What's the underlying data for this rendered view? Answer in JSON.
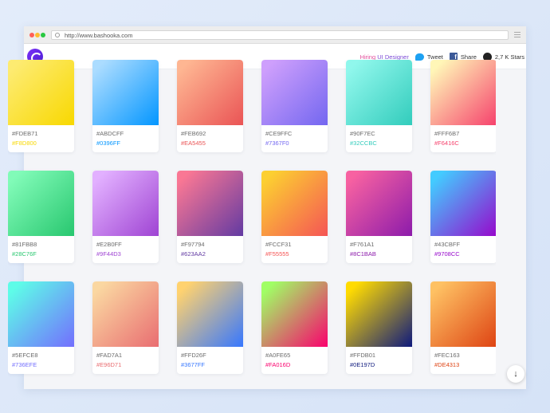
{
  "browser": {
    "url": "http://www.bashooka.com"
  },
  "header": {
    "hiring_prefix": "Hiring",
    "hiring_role": "UI Designer",
    "tweet_label": "Tweet",
    "share_label": "Share",
    "stars_label": "2,7 K Stars"
  },
  "gradients": [
    {
      "color1": "#FDEB71",
      "color2": "#F8D800"
    },
    {
      "color1": "#ABDCFF",
      "color2": "#0396FF"
    },
    {
      "color1": "#FEB692",
      "color2": "#EA5455"
    },
    {
      "color1": "#CE9FFC",
      "color2": "#7367F0"
    },
    {
      "color1": "#90F7EC",
      "color2": "#32CCBC"
    },
    {
      "color1": "#FFF6B7",
      "color2": "#F6416C"
    },
    {
      "color1": "#81FBB8",
      "color2": "#28C76F"
    },
    {
      "color1": "#E2B0FF",
      "color2": "#9F44D3"
    },
    {
      "color1": "#F97794",
      "color2": "#623AA2"
    },
    {
      "color1": "#FCCF31",
      "color2": "#F55555"
    },
    {
      "color1": "#F761A1",
      "color2": "#8C1BAB"
    },
    {
      "color1": "#43CBFF",
      "color2": "#9708CC"
    },
    {
      "color1": "#5EFCE8",
      "color2": "#736EFE"
    },
    {
      "color1": "#FAD7A1",
      "color2": "#E96D71"
    },
    {
      "color1": "#FFD26F",
      "color2": "#3677FF"
    },
    {
      "color1": "#A0FE65",
      "color2": "#FA016D"
    },
    {
      "color1": "#FFDB01",
      "color2": "#0E197D"
    },
    {
      "color1": "#FEC163",
      "color2": "#DE4313"
    }
  ]
}
